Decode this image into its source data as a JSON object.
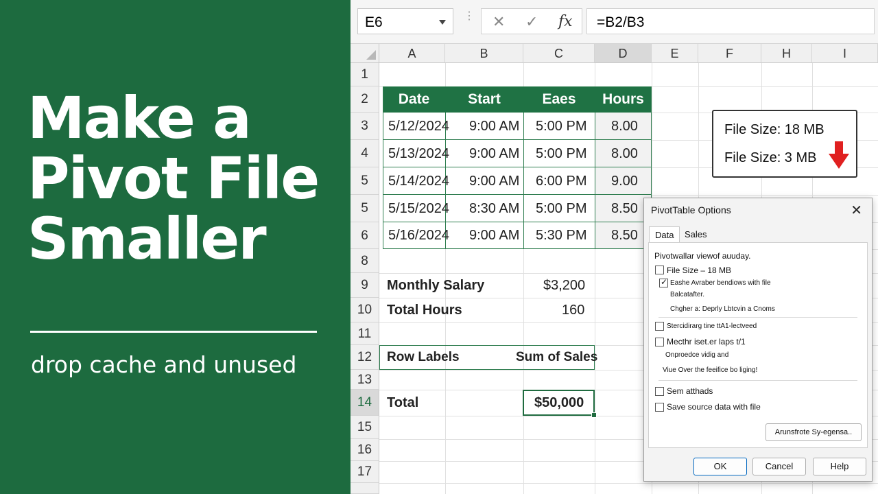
{
  "thumbnail": {
    "headline": [
      "Make a",
      "Pivot File",
      "Smaller"
    ],
    "subtitle": "drop cache and unused"
  },
  "formula_bar": {
    "name_box": "E6",
    "cancel_glyph": "✕",
    "enter_glyph": "✓",
    "fx_label": "fx",
    "formula": "=B2/B3"
  },
  "sheet": {
    "columns": [
      "A",
      "B",
      "C",
      "D",
      "E",
      "F",
      "H",
      "I"
    ],
    "active_column": "D",
    "rows": [
      "1",
      "2",
      "3",
      "4",
      "5",
      "5",
      "6",
      "8",
      "9",
      "10",
      "11",
      "12",
      "13",
      "14",
      "15",
      "16",
      "17"
    ],
    "table_headers": [
      "Date",
      "Start",
      "Eaes",
      "Hours"
    ],
    "table_rows": [
      [
        "5/12/2024",
        "9:00 AM",
        "5:00 PM",
        "8.00"
      ],
      [
        "5/13/2024",
        "9:00 AM",
        "5:00 PM",
        "8.00"
      ],
      [
        "5/14/2024",
        "9:00 AM",
        "6:00 PM",
        "9.00"
      ],
      [
        "5/15/2024",
        "8:30 AM",
        "5:00 PM",
        "8.50"
      ],
      [
        "5/16/2024",
        "9:00 AM",
        "5:30 PM",
        "8.50"
      ]
    ],
    "monthly_salary_label": "Monthly Salary",
    "monthly_salary_value": "$3,200",
    "total_hours_label": "Total Hours",
    "total_hours_value": "160",
    "row_labels": "Row Labels",
    "sum_of_sales": "Sum of Sales",
    "total_label": "Total",
    "total_value": "$50,000"
  },
  "callout": {
    "before": "File Size: 18 MB",
    "after": "File Size: 3 MB",
    "arrow_color": "#e02020"
  },
  "dialog": {
    "title": "PivotTable Options",
    "close_glyph": "✕",
    "tabs": [
      "Data",
      "Sales"
    ],
    "heading": "Pivotwallar viewof auuday.",
    "opt_file_size": "File Size – 18 MB",
    "opt_save_with_file": "Eashe Avraber bendiows with file",
    "note_1": "Balcatafter.",
    "note_2": "Chgher a: Deprly Lbtcvin a Cnoms",
    "opt_2": "Stercidirarg tine ttA1-lectveed",
    "opt_3": "Mecthr iset.er laps t/1",
    "note_3": "Onproedce vidig and",
    "note_4": "Viue Over the feeifice bo liging!",
    "opt_4": "Sem atthads",
    "opt_5": "Save source data with file",
    "advanced_button": "Arunsfrote Sy-egensa..",
    "ok": "OK",
    "cancel": "Cancel",
    "help": "Help"
  }
}
